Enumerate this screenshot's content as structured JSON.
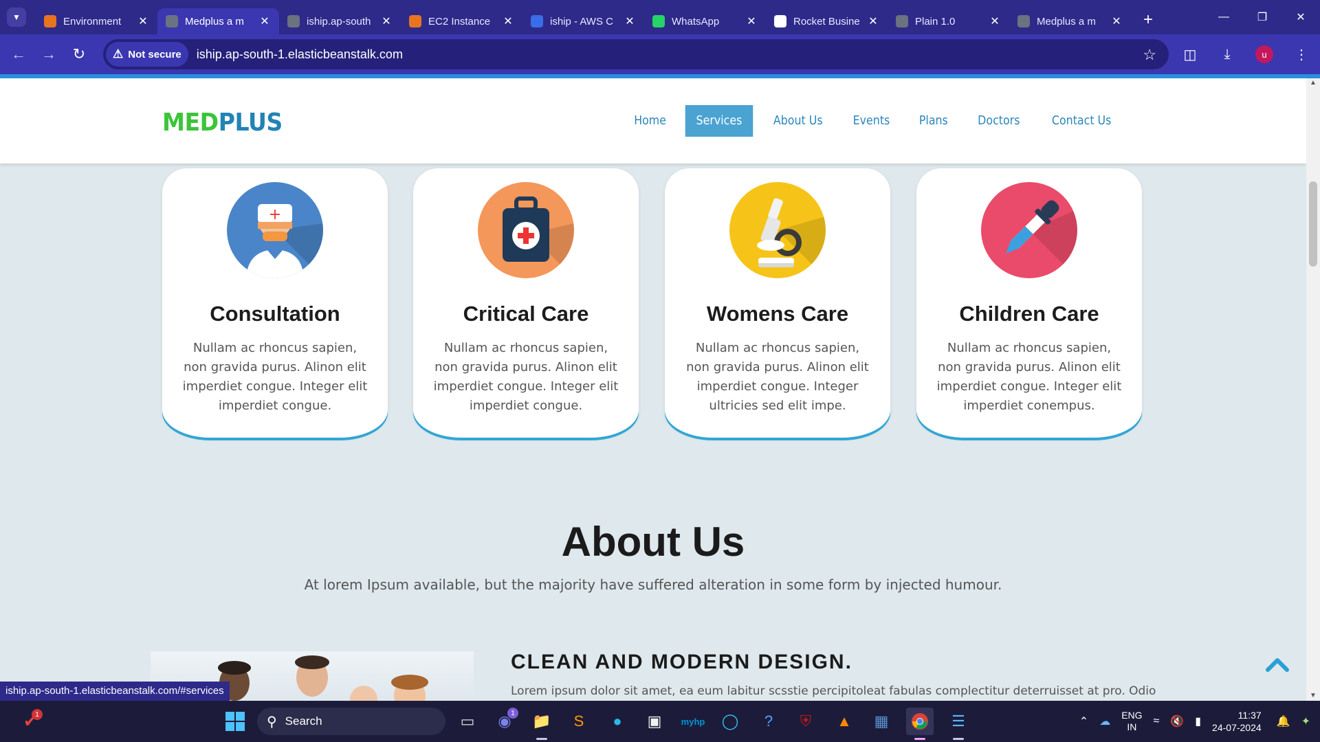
{
  "browser": {
    "tabs": [
      {
        "title": "Environment",
        "favicon_color": "#e8741f",
        "favicon": "env-icon"
      },
      {
        "title": "Medplus a m",
        "favicon_color": "#6b7280",
        "favicon": "globe-icon",
        "active": true
      },
      {
        "title": "iship.ap-south",
        "favicon_color": "#6b7280",
        "favicon": "globe-icon"
      },
      {
        "title": "EC2 Instance",
        "favicon_color": "#e8741f",
        "favicon": "ec2-icon"
      },
      {
        "title": "iship - AWS C",
        "favicon_color": "#3a6ee8",
        "favicon": "cloud-icon"
      },
      {
        "title": "WhatsApp",
        "favicon_color": "#25d366",
        "favicon": "whatsapp-icon"
      },
      {
        "title": "Rocket Busine",
        "favicon_color": "#ffffff",
        "favicon": "rocket-icon"
      },
      {
        "title": "Plain 1.0",
        "favicon_color": "#6b7280",
        "favicon": "globe-icon"
      },
      {
        "title": "Medplus a m",
        "favicon_color": "#6b7280",
        "favicon": "globe-icon"
      }
    ],
    "security_label": "Not secure",
    "url": "iship.ap-south-1.elasticbeanstalk.com",
    "avatar_initial": "u",
    "status_url": "iship.ap-south-1.elasticbeanstalk.com/#services"
  },
  "site": {
    "logo_med": "MED",
    "logo_plus": "PLUS",
    "nav": [
      {
        "label": "Home"
      },
      {
        "label": "Services",
        "active": true
      },
      {
        "label": "About Us"
      },
      {
        "label": "Events"
      },
      {
        "label": "Plans"
      },
      {
        "label": "Doctors"
      },
      {
        "label": "Contact Us"
      }
    ],
    "services": [
      {
        "title": "Consultation",
        "text": "Nullam ac rhoncus sapien, non gravida purus. Alinon elit imperdiet congue. Integer elit imperdiet congue.",
        "icon": "doctor-icon",
        "color": "#4a85c9"
      },
      {
        "title": "Critical Care",
        "text": "Nullam ac rhoncus sapien, non gravida purus. Alinon elit imperdiet congue. Integer elit imperdiet congue.",
        "icon": "medical-kit-icon",
        "color": "#f4975a"
      },
      {
        "title": "Womens Care",
        "text": "Nullam ac rhoncus sapien, non gravida purus. Alinon elit imperdiet congue. Integer ultricies sed elit impe.",
        "icon": "microscope-icon",
        "color": "#f6c418"
      },
      {
        "title": "Children Care",
        "text": "Nullam ac rhoncus sapien, non gravida purus. Alinon elit imperdiet congue. Integer elit imperdiet conempus.",
        "icon": "dropper-icon",
        "color": "#ea4b6a"
      }
    ],
    "about": {
      "title": "About Us",
      "subtitle": "At lorem Ipsum available, but the majority have suffered alteration in some form by injected humour.",
      "heading": "CLEAN AND MODERN DESIGN.",
      "text": "Lorem ipsum dolor sit amet, ea eum labitur scsstie percipitoleat fabulas complectitur deterruisset at pro. Odio"
    }
  },
  "taskbar": {
    "search_placeholder": "Search",
    "lang_primary": "ENG",
    "lang_secondary": "IN",
    "time": "11:37",
    "date": "24-07-2024",
    "notification_count": "1",
    "teams_count": "1"
  }
}
